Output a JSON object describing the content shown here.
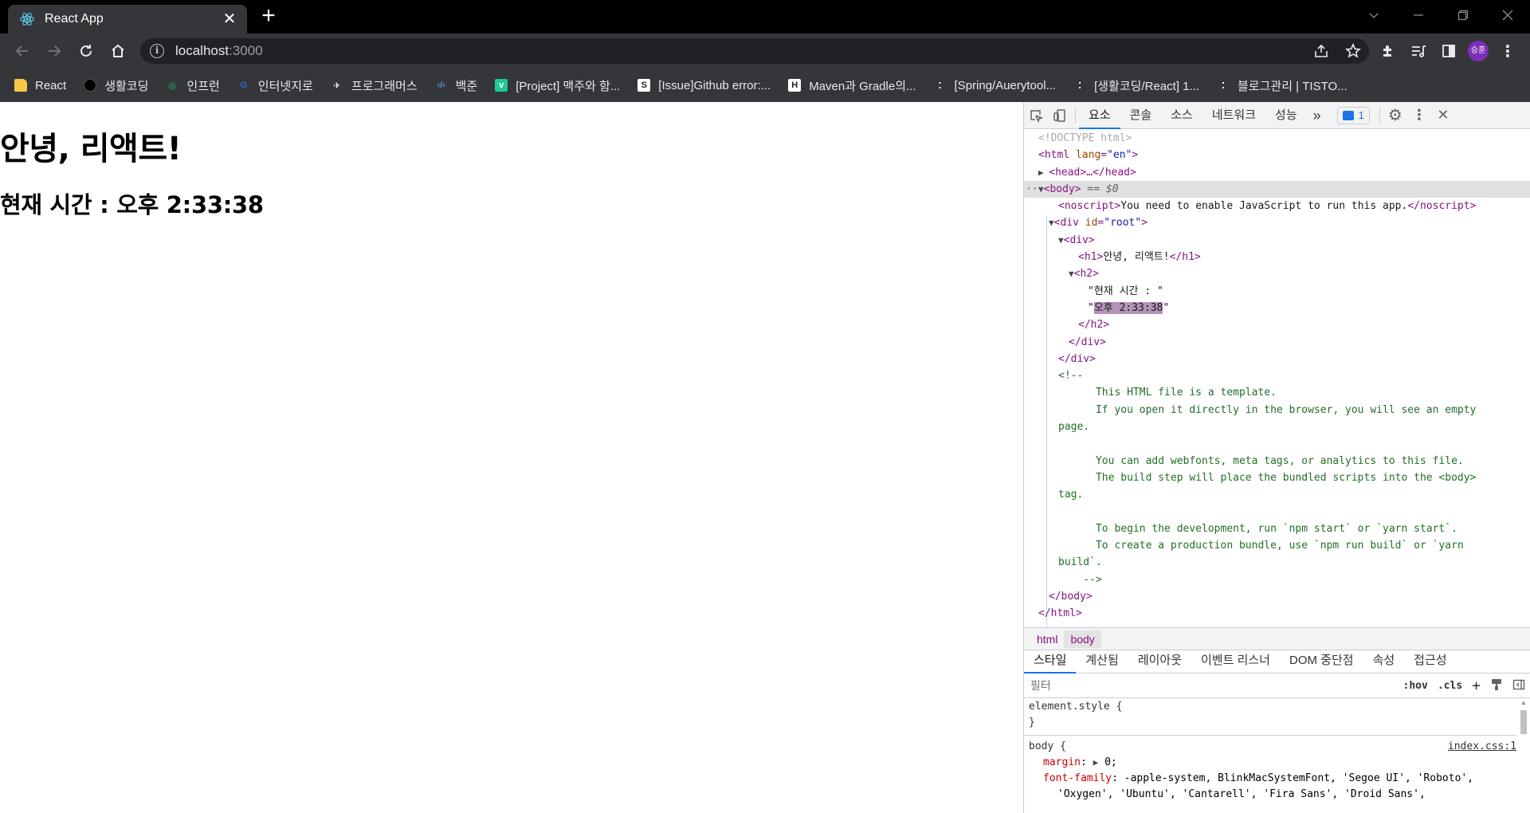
{
  "browser": {
    "tab_title": "React App",
    "url_host": "localhost",
    "url_port": ":3000",
    "avatar_text": "승훈",
    "bookmarks": [
      {
        "label": "React",
        "icon": "folder-icon",
        "color": "#f7c948"
      },
      {
        "label": "생활코딩",
        "icon": "black-circle-icon",
        "color": "#000000"
      },
      {
        "label": "인프런",
        "icon": "inflearn-icon",
        "color": "#1dc078"
      },
      {
        "label": "인터넷지로",
        "icon": "giro-icon",
        "color": "#2b6cd6"
      },
      {
        "label": "프로그래머스",
        "icon": "programmers-icon",
        "color": "#ffffff"
      },
      {
        "label": "백준",
        "icon": "code-brackets-icon",
        "color": "#5a8dee"
      },
      {
        "label": "[Project] 맥주와 함...",
        "icon": "velog-icon",
        "color": "#20c997"
      },
      {
        "label": "[Issue]Github error:...",
        "icon": "s-page-icon",
        "color": "#ffffff"
      },
      {
        "label": "Maven과 Gradle의...",
        "icon": "h-page-icon",
        "color": "#ffffff"
      },
      {
        "label": "[Spring/Auerytool...",
        "icon": "tistory-icon",
        "color": "#ffffff"
      },
      {
        "label": "[생활코딩/React] 1...",
        "icon": "tistory-icon",
        "color": "#ffffff"
      },
      {
        "label": "블로그관리 | TISTO...",
        "icon": "tistory-icon",
        "color": "#ffffff"
      }
    ]
  },
  "page": {
    "h1": "안녕, 리액트!",
    "h2": "현재 시간 : 오후 2:33:38"
  },
  "devtools": {
    "tabs": [
      "요소",
      "콘솔",
      "소스",
      "네트워크",
      "성능"
    ],
    "active_tab": "요소",
    "overflow": "»",
    "message_count": "1",
    "dom": {
      "doctype": "<!DOCTYPE html>",
      "html_open": "html",
      "lang_attr": "lang",
      "lang_val": "\"en\"",
      "head": "<head>…</head>",
      "body_tag": "<body>",
      "body_eq": " == $0",
      "noscript_open": "<noscript>",
      "noscript_text": "You need to enable JavaScript to run this app.",
      "noscript_close": "</noscript>",
      "div_root_tag": "div",
      "id_attr": "id",
      "id_val": "\"root\"",
      "div_open": "<div>",
      "h1_open": "<h1>",
      "h1_text": "안녕, 리액트!",
      "h1_close": "</h1>",
      "h2_open": "<h2>",
      "h2_text1": "\"현재 시간 : \"",
      "h2_text2": "오후 2:33:38",
      "h2_close": "</h2>",
      "div_close": "</div>",
      "comment_open": "<!--",
      "comment_lines": [
        "      This HTML file is a template.",
        "      If you open it directly in the browser, you will see an empty",
        "page.",
        "",
        "      You can add webfonts, meta tags, or analytics to this file.",
        "      The build step will place the bundled scripts into the <body>",
        "tag.",
        "",
        "      To begin the development, run `npm start` or `yarn start`.",
        "      To create a production bundle, use `npm run build` or `yarn",
        "build`.",
        "    -->"
      ],
      "body_close": "</body>",
      "html_close": "</html>"
    },
    "breadcrumbs": [
      "html",
      "body"
    ],
    "sub_tabs": [
      "스타일",
      "계산됨",
      "레이아웃",
      "이벤트 리스너",
      "DOM 중단점",
      "속성",
      "접근성"
    ],
    "filter_placeholder": "필터",
    "hov": ":hov",
    "cls": ".cls",
    "styles": {
      "element_style": "element.style {",
      "close": "}",
      "body_selector": "body {",
      "body_source": "index.css:1",
      "margin_prop": "margin",
      "margin_val": "0;",
      "font_prop": "font-family",
      "font_val": "-apple-system, BlinkMacSystemFont, 'Segoe UI', 'Roboto',",
      "font_val2": "'Oxygen', 'Ubuntu', 'Cantarell', 'Fira Sans', 'Droid Sans',"
    }
  }
}
